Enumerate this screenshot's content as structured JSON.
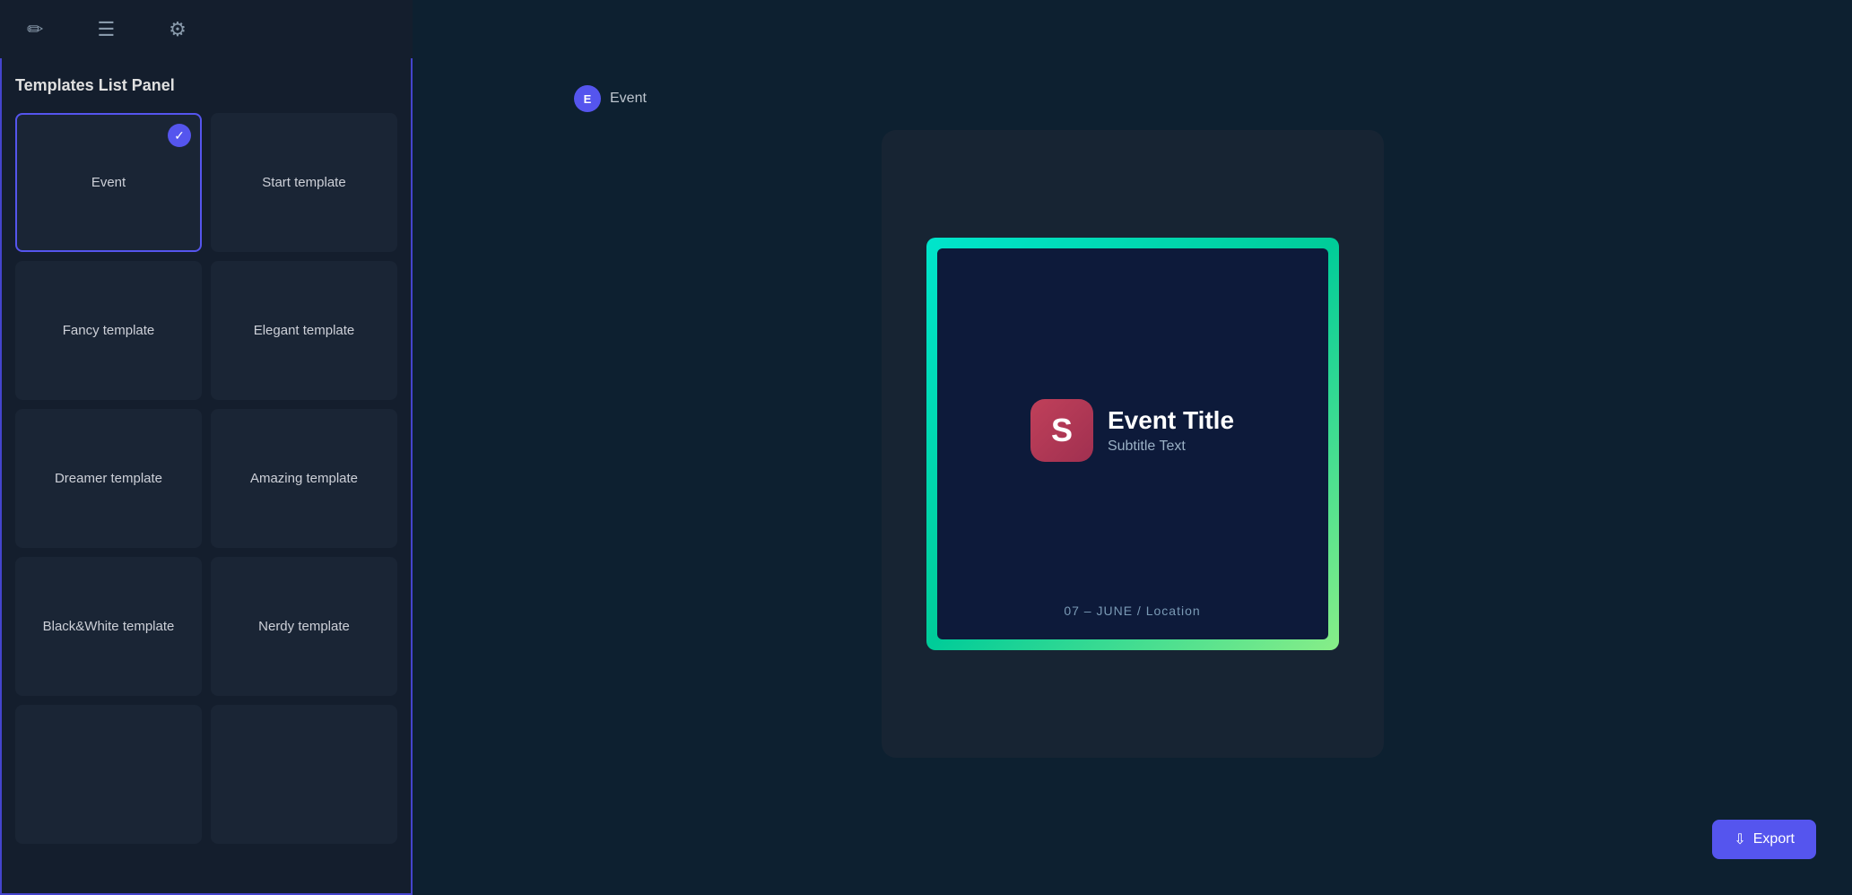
{
  "toolbar": {
    "icon_edit": "✏️",
    "icon_menu": "≡",
    "icon_settings": "⚙"
  },
  "panel": {
    "title": "Templates List Panel",
    "templates": [
      {
        "id": "event",
        "label": "Event",
        "selected": true
      },
      {
        "id": "start",
        "label": "Start template",
        "selected": false
      },
      {
        "id": "fancy",
        "label": "Fancy template",
        "selected": false
      },
      {
        "id": "elegant",
        "label": "Elegant template",
        "selected": false
      },
      {
        "id": "dreamer",
        "label": "Dreamer template",
        "selected": false
      },
      {
        "id": "amazing",
        "label": "Amazing template",
        "selected": false
      },
      {
        "id": "blackwhite",
        "label": "Black&White template",
        "selected": false
      },
      {
        "id": "nerdy",
        "label": "Nerdy template",
        "selected": false
      },
      {
        "id": "extra1",
        "label": "",
        "selected": false
      },
      {
        "id": "extra2",
        "label": "",
        "selected": false
      }
    ]
  },
  "preview": {
    "header_icon_label": "E",
    "header_label": "Event",
    "card": {
      "logo_letter": "S",
      "title": "Event Title",
      "subtitle": "Subtitle Text",
      "date": "07 – JUNE / Location"
    }
  },
  "export_button_label": " Export"
}
